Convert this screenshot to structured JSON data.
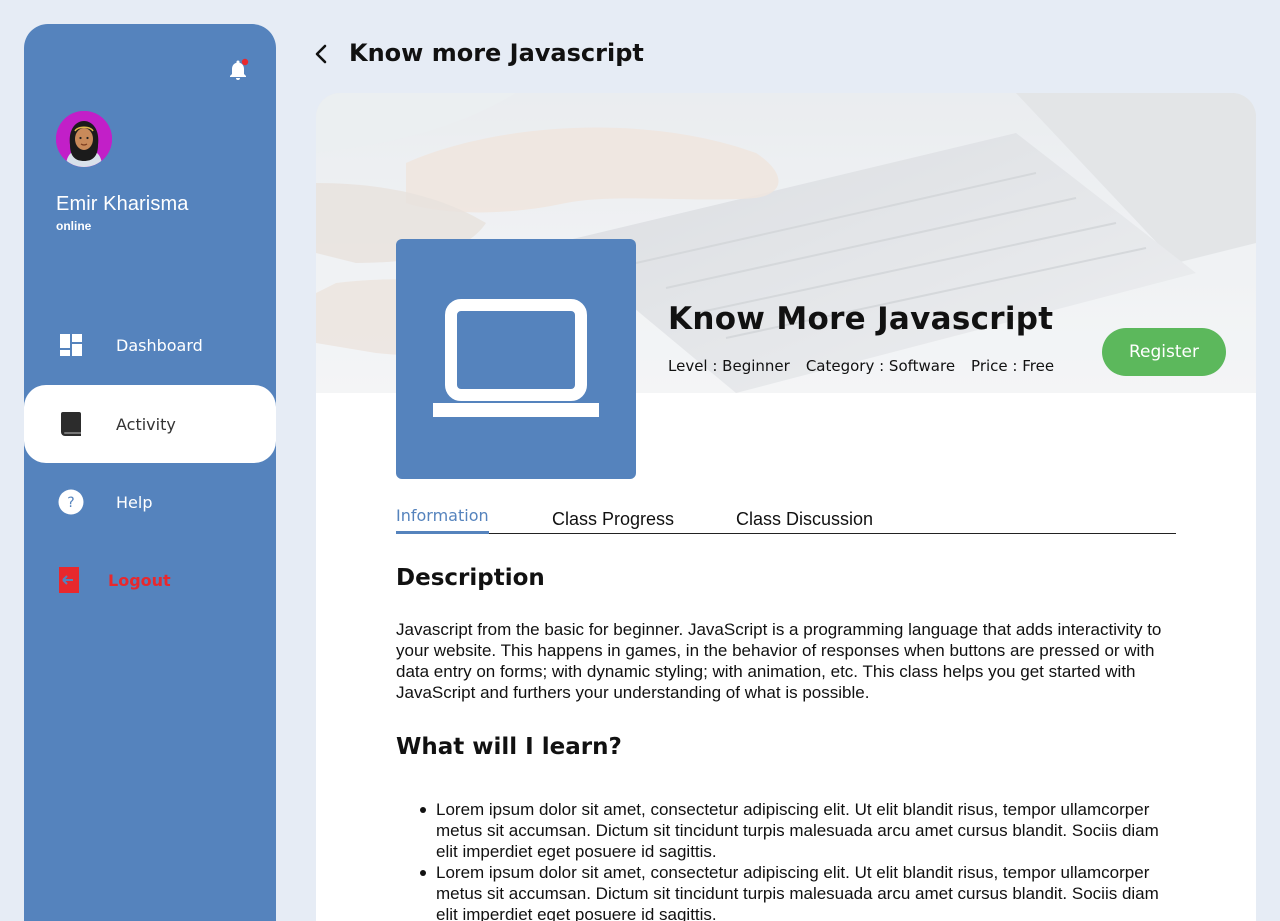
{
  "sidebar": {
    "user": {
      "name": "Emir Kharisma",
      "status": "online"
    },
    "items": [
      {
        "label": "Dashboard",
        "icon": "dashboard-grid-icon"
      },
      {
        "label": "Activity",
        "icon": "book-icon"
      },
      {
        "label": "Help",
        "icon": "help-circle-icon"
      },
      {
        "label": "Logout",
        "icon": "logout-icon"
      }
    ],
    "notification_icon": "bell-icon"
  },
  "header": {
    "title": "Know more Javascript",
    "back_icon": "chevron-left-icon"
  },
  "course": {
    "title": "Know More Javascript",
    "level": "Level : Beginner",
    "category": "Category : Software",
    "price": "Price : Free",
    "register_label": "Register",
    "thumbnail_icon": "laptop-icon"
  },
  "tabs": [
    {
      "label": "Information",
      "active": true
    },
    {
      "label": "Class Progress",
      "active": false
    },
    {
      "label": "Class Discussion",
      "active": false
    }
  ],
  "content": {
    "description_title": "Description",
    "description": "Javascript from the basic for beginner. JavaScript is a programming language that adds interactivity to your website. This happens in games, in the behavior of responses when buttons are pressed or with data entry on forms; with dynamic styling; with animation, etc. This class helps you get started with JavaScript and furthers your understanding of what is possible.",
    "learn_title": "What will I learn?",
    "learn_items": [
      "Lorem ipsum dolor sit amet, consectetur adipiscing elit. Ut elit blandit risus, tempor ullamcorper metus sit accumsan. Dictum sit tincidunt turpis malesuada arcu amet cursus blandit. Sociis diam elit imperdiet eget posuere id sagittis.",
      "Lorem ipsum dolor sit amet, consectetur adipiscing elit. Ut elit blandit risus, tempor ullamcorper metus sit accumsan. Dictum sit tincidunt turpis malesuada arcu amet cursus blandit. Sociis diam elit imperdiet eget posuere id sagittis."
    ]
  },
  "colors": {
    "page_bg": "#e6ecf5",
    "sidebar": "#5583bd",
    "accent": "#5583bd",
    "register": "#5cb85c",
    "logout": "#e8282d"
  }
}
